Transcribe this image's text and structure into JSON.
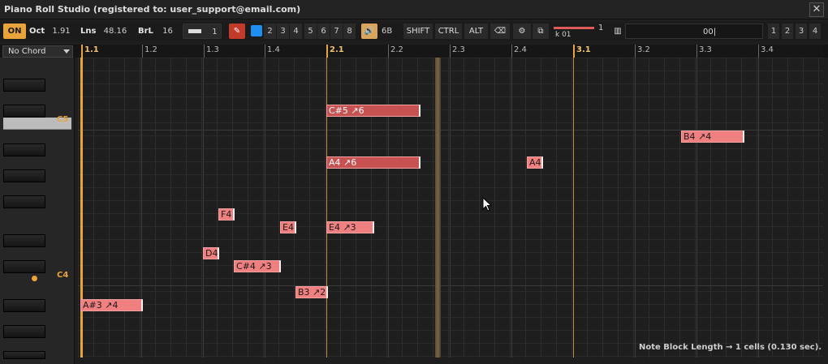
{
  "window": {
    "title": "Piano Roll Studio  (registered to: user_support@email.com)"
  },
  "toolbar": {
    "on_label": "ON",
    "oct_label": "Oct",
    "oct_value": "1.91",
    "lns_label": "Lns",
    "lns_value": "48.16",
    "brl_label": "BrL",
    "brl_value": "16",
    "voice_value": "1",
    "channels": [
      "2",
      "3",
      "4",
      "5",
      "6",
      "7",
      "8"
    ],
    "volume_value": "6B",
    "shift_label": "SHIFT",
    "ctrl_label": "CTRL",
    "alt_label": "ALT",
    "track_value": "1",
    "track_name": "k 01",
    "input_value": "00|",
    "pages": [
      "1",
      "2",
      "3",
      "4"
    ]
  },
  "chord": {
    "selected": "No Chord"
  },
  "ruler": {
    "ticks": [
      "1.1",
      "1.2",
      "1.3",
      "1.4",
      "2.1",
      "2.2",
      "2.3",
      "2.4",
      "3.1",
      "3.2",
      "3.3",
      "3.4"
    ]
  },
  "keys": {
    "c5_label": "C5",
    "c4_label": "C4"
  },
  "notes": [
    {
      "label": "C#5 ↗6"
    },
    {
      "label": "B4 ↗4"
    },
    {
      "label": "A4 ↗6"
    },
    {
      "label": "A4"
    },
    {
      "label": "F4"
    },
    {
      "label": "E4"
    },
    {
      "label": "E4 ↗3"
    },
    {
      "label": "D4"
    },
    {
      "label": "C#4 ↗3"
    },
    {
      "label": "B3 ↗2"
    },
    {
      "label": "A#3 ↗4"
    }
  ],
  "status": {
    "text": "Note Block Length → 1 cells (0.130 sec)."
  }
}
